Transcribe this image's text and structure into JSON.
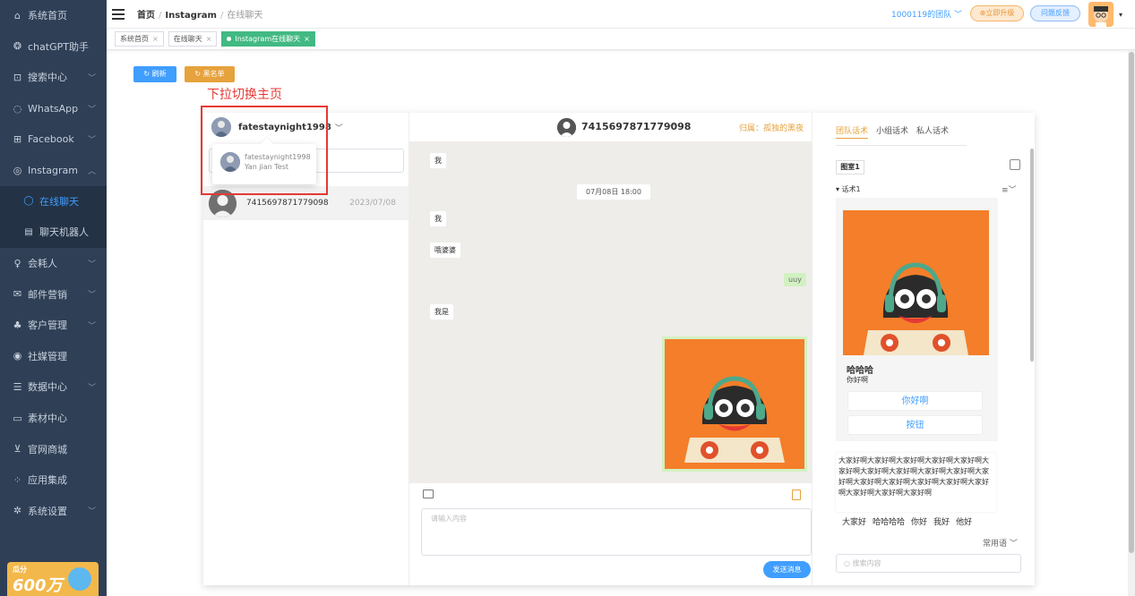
{
  "sidebar": {
    "items": [
      {
        "label": "系统首页",
        "icon": "home-icon",
        "chev": ""
      },
      {
        "label": "chatGPT助手",
        "icon": "openai-icon",
        "chev": ""
      },
      {
        "label": "搜索中心",
        "icon": "search-box-icon",
        "chev": "﹀"
      },
      {
        "label": "WhatsApp",
        "icon": "whatsapp-icon",
        "chev": "﹀"
      },
      {
        "label": "Facebook",
        "icon": "facebook-icon",
        "chev": "﹀"
      },
      {
        "label": "Instagram",
        "icon": "instagram-icon",
        "chev": "︿"
      }
    ],
    "subitems": [
      {
        "label": "在线聊天",
        "icon": "chat-bubble-icon"
      },
      {
        "label": "聊天机器人",
        "icon": "robot-doc-icon"
      }
    ],
    "items2": [
      {
        "label": "会耗人",
        "icon": "bulb-icon",
        "chev": "﹀"
      },
      {
        "label": "邮件营销",
        "icon": "mail-icon",
        "chev": "﹀"
      },
      {
        "label": "客户管理",
        "icon": "users-icon",
        "chev": "﹀"
      },
      {
        "label": "社媒管理",
        "icon": "social-icon",
        "chev": ""
      },
      {
        "label": "数据中心",
        "icon": "database-icon",
        "chev": "﹀"
      },
      {
        "label": "素材中心",
        "icon": "folder-icon",
        "chev": ""
      },
      {
        "label": "官网商城",
        "icon": "cart-icon",
        "chev": ""
      },
      {
        "label": "应用集成",
        "icon": "apps-icon",
        "chev": ""
      },
      {
        "label": "系统设置",
        "icon": "settings-icon",
        "chev": "﹀"
      }
    ],
    "promo_small": "瓜分",
    "promo_big": "600万"
  },
  "topbar": {
    "crumb_home": "首页",
    "crumb_mid": "Instagram",
    "crumb_current": "在线聊天",
    "team": "1000119的团队 ﹀",
    "upgrade": "⊗立即升级",
    "feedback": "问题反馈"
  },
  "tags": [
    {
      "label": "系统首页"
    },
    {
      "label": "在线聊天"
    },
    {
      "label": "Instagram在线聊天"
    }
  ],
  "actions": {
    "refresh": "↻ 刷新",
    "blacklist": "↻ 黑名单"
  },
  "annotation": "下拉切换主页",
  "account": {
    "name": "fatestaynight1998",
    "dd_line1": "fatestaynight1998",
    "dd_line2": "Yan jian Test"
  },
  "conversation": {
    "id": "7415697871779098",
    "date": "2023/07/08"
  },
  "chat": {
    "contact": "7415697871779098",
    "owner": "归属：孤独的黑夜",
    "messages": [
      {
        "text": "我"
      },
      {
        "text": "我"
      },
      {
        "text": "哦婆婆"
      },
      {
        "text": "uuy"
      },
      {
        "text": "我是"
      }
    ],
    "time": "07月08日 18:00",
    "input_placeholder": "请输入内容",
    "send": "发送消息"
  },
  "right": {
    "tabs": [
      "团队话术",
      "小组话术",
      "私人话术"
    ],
    "category": "图室1",
    "section": "▾ 话术1",
    "card_title": "哈哈哈",
    "card_sub": "你好啊",
    "card_btn1": "你好啊",
    "card_btn2": "按钮",
    "long_text": "大家好啊大家好啊大家好啊大家好啊大家好啊大家好啊大家好啊大家好啊大家好啊大家好啊大家好啊大家好啊大家好啊大家好啊大家好啊大家好啊大家好啊大家好啊大家好啊",
    "phrases": [
      "大家好",
      "哈哈哈哈",
      "你好",
      "我好",
      "他好"
    ],
    "common": "常用语 ﹀",
    "search_placeholder": "○ 搜索内容"
  },
  "colors": {
    "sidebar": "#2f3f56",
    "accent": "#409eff",
    "tag_active": "#42b983",
    "warning": "#e6a23c",
    "annotation": "#e53935"
  }
}
